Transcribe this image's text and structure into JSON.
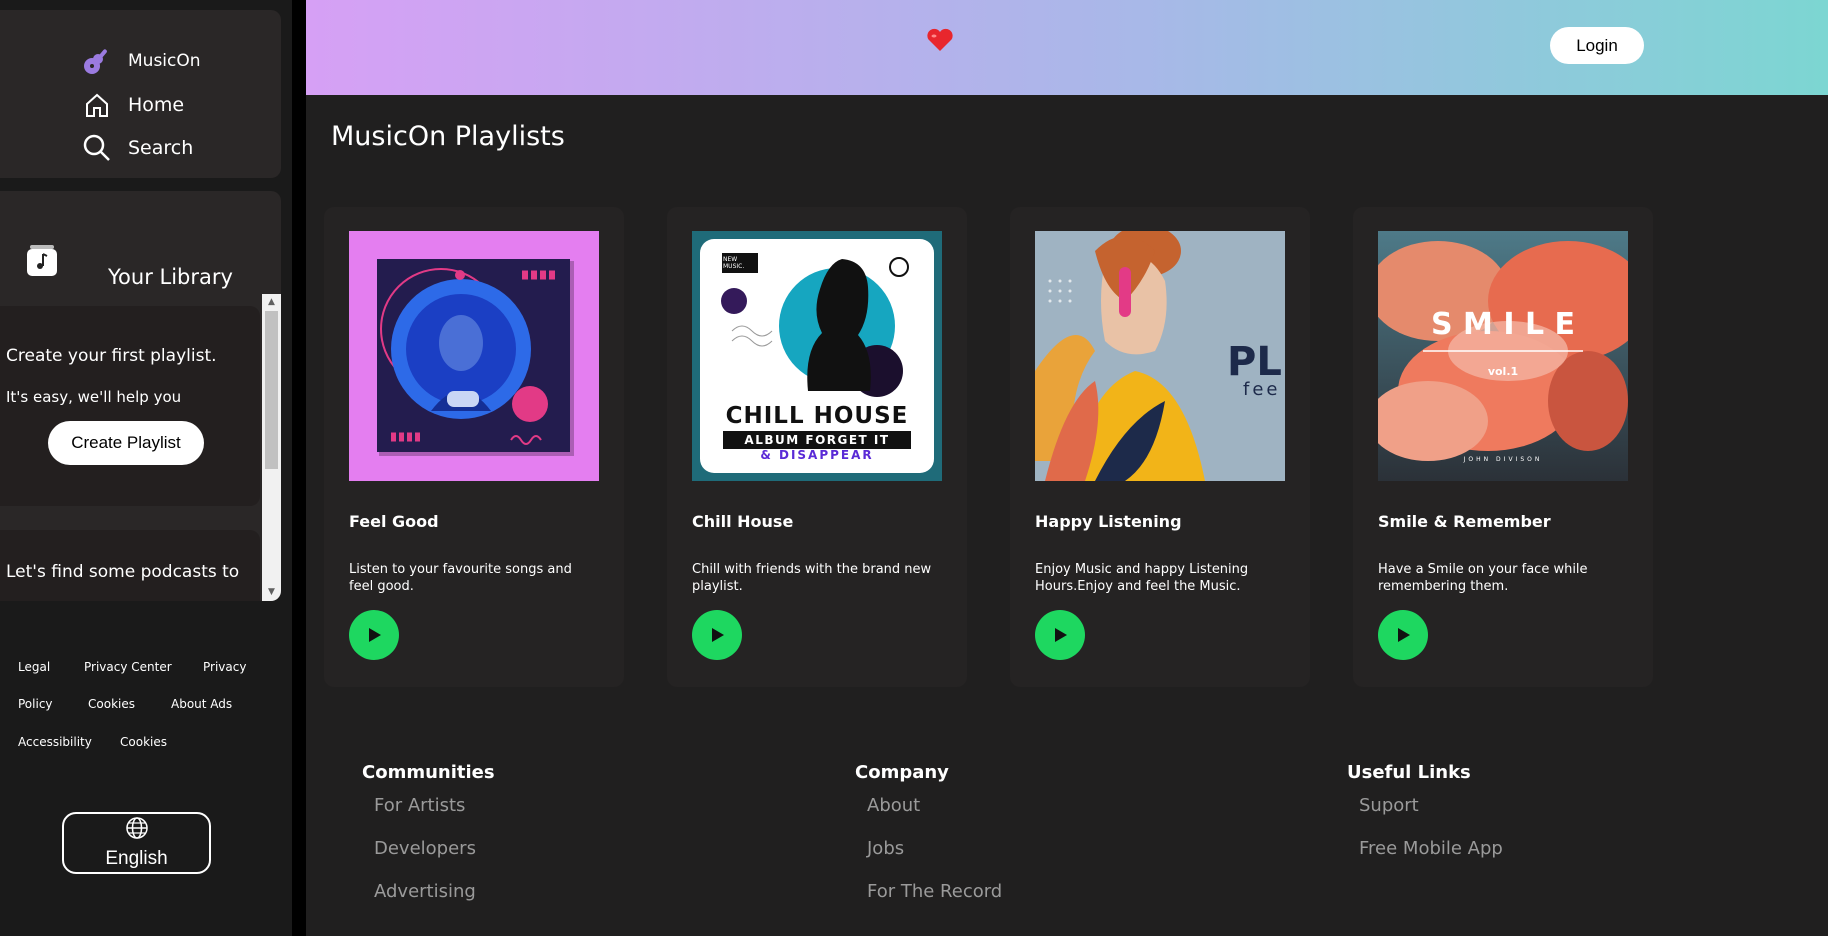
{
  "app": {
    "brand": "MusicOn"
  },
  "sidebar": {
    "nav": [
      {
        "label": "MusicOn",
        "icon": "guitar-icon"
      },
      {
        "label": "Home",
        "icon": "home-icon"
      },
      {
        "label": "Search",
        "icon": "search-icon"
      }
    ],
    "library_title": "Your Library",
    "create_card": {
      "title": "Create your first playlist.",
      "subtitle": "It's easy, we'll help you",
      "button": "Create Playlist"
    },
    "podcast_card": {
      "title": "Let's find some podcasts to"
    },
    "footer_links": [
      "Legal",
      "Privacy Center",
      "Privacy",
      "Policy",
      "Cookies",
      "About Ads",
      "Accessibility",
      "Cookies"
    ],
    "language": "English"
  },
  "header": {
    "login": "Login"
  },
  "main": {
    "title": "MusicOn Playlists",
    "playlists": [
      {
        "name": "Feel Good",
        "desc": "Listen to your favourite songs and feel good."
      },
      {
        "name": "Chill House",
        "desc": "Chill with friends with the brand new playlist."
      },
      {
        "name": "Happy Listening",
        "desc": "Enjoy Music and happy Listening Hours.Enjoy and feel the Music."
      },
      {
        "name": "Smile & Remember",
        "desc": "Have a Smile on your face while remembering them."
      }
    ],
    "covers": {
      "chill": {
        "badge": "NEW MUSIC.",
        "title": "CHILL HOUSE",
        "line2": "ALBUM FORGET IT",
        "line3": "& DISAPPEAR"
      },
      "happy": {
        "big": "PL",
        "small": "fee"
      },
      "smile": {
        "title": "S M I L E",
        "vol": "vol.1",
        "artist": "JOHN DIVISON"
      }
    }
  },
  "footer": {
    "columns": [
      {
        "title": "Communities",
        "links": [
          "For Artists",
          "Developers",
          "Advertising"
        ]
      },
      {
        "title": "Company",
        "links": [
          "About",
          "Jobs",
          "For The Record"
        ]
      },
      {
        "title": "Useful Links",
        "links": [
          "Suport",
          "Free Mobile App"
        ]
      }
    ]
  },
  "colors": {
    "accent_green": "#1ed760",
    "sidebar_bg": "#2a2727",
    "main_bg": "#201f1f"
  }
}
